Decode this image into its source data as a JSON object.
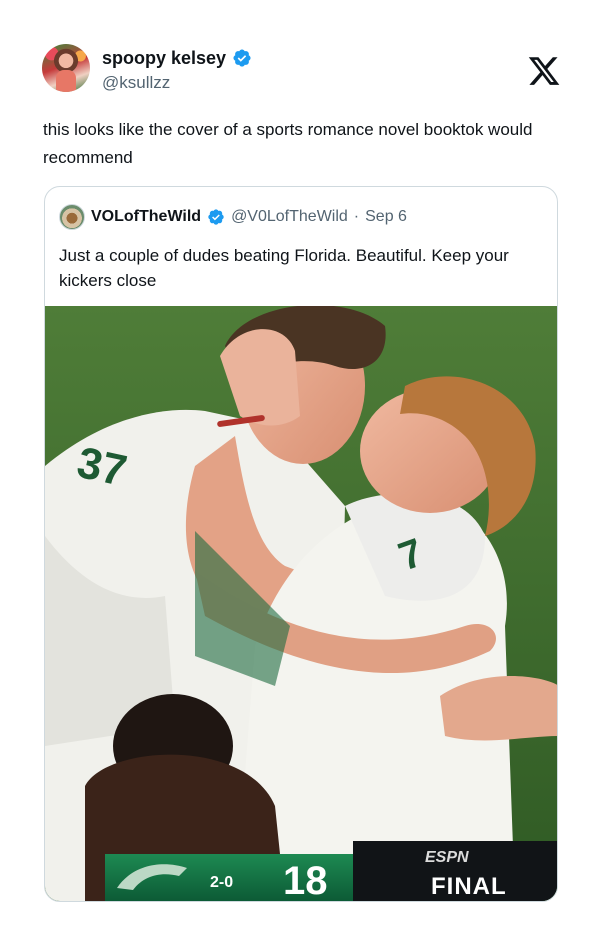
{
  "tweet": {
    "display_name": "spoopy kelsey",
    "handle": "@ksullzz",
    "text": "this looks like the cover of a sports romance novel booktok would recommend"
  },
  "quoted": {
    "display_name": "VOLofTheWild",
    "handle": "@V0LofTheWild",
    "separator": "·",
    "date": "Sep 6",
    "text": "Just a couple of dudes beating Florida. Beautiful. Keep your kickers close"
  },
  "image": {
    "jersey_numbers": [
      "37",
      "7"
    ],
    "scoreboard": {
      "record": "2-0",
      "score": "18",
      "network": "ESPN",
      "status": "FINAL"
    }
  },
  "colors": {
    "verified": "#1d9bf0",
    "text": "#0f1419",
    "muted": "#536471",
    "border": "#cfd9de",
    "usf_green": "#0f6b43",
    "turf": "#3e6e2e"
  },
  "icons": [
    "verified-badge-icon",
    "x-logo-icon"
  ]
}
